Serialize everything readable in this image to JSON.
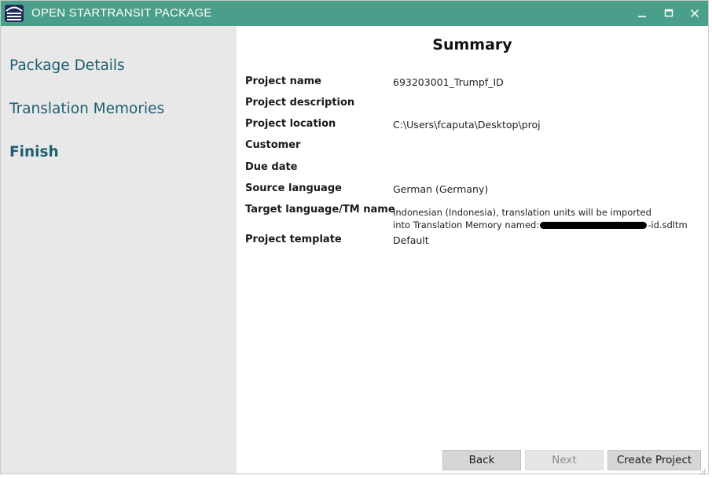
{
  "window": {
    "title": "OPEN STARTRANSIT PACKAGE",
    "icons": {
      "app": "app-logo-icon",
      "minimize": "minimize-icon",
      "maximize": "maximize-icon",
      "close": "close-icon"
    }
  },
  "sidebar": {
    "items": [
      {
        "label": "Package Details",
        "active": false
      },
      {
        "label": "Translation Memories",
        "active": false
      },
      {
        "label": "Finish",
        "active": true
      }
    ]
  },
  "summary": {
    "title": "Summary",
    "rows": [
      {
        "label": "Project name",
        "value": "693203001_Trumpf_ID"
      },
      {
        "label": "Project description",
        "value": ""
      },
      {
        "label": "Project location",
        "value": "C:\\Users\\fcaputa\\Desktop\\proj"
      },
      {
        "label": "Customer",
        "value": ""
      },
      {
        "label": "Due date",
        "value": ""
      },
      {
        "label": "Source language",
        "value": "German (Germany)"
      },
      {
        "label": "Target language/TM name",
        "value_line1": "Indonesian (Indonesia), translation units will be imported",
        "value_line2_prefix": " into Translation Memory named:",
        "value_line2_suffix": "-id.sdltm"
      },
      {
        "label": "Project template",
        "value": "Default"
      }
    ]
  },
  "buttons": {
    "back": "Back",
    "next": "Next",
    "create": "Create Project"
  },
  "colors": {
    "titlebar": "#4a9f8a",
    "nav_text": "#1d5f70",
    "sidebar_bg": "#e8e8e8"
  }
}
